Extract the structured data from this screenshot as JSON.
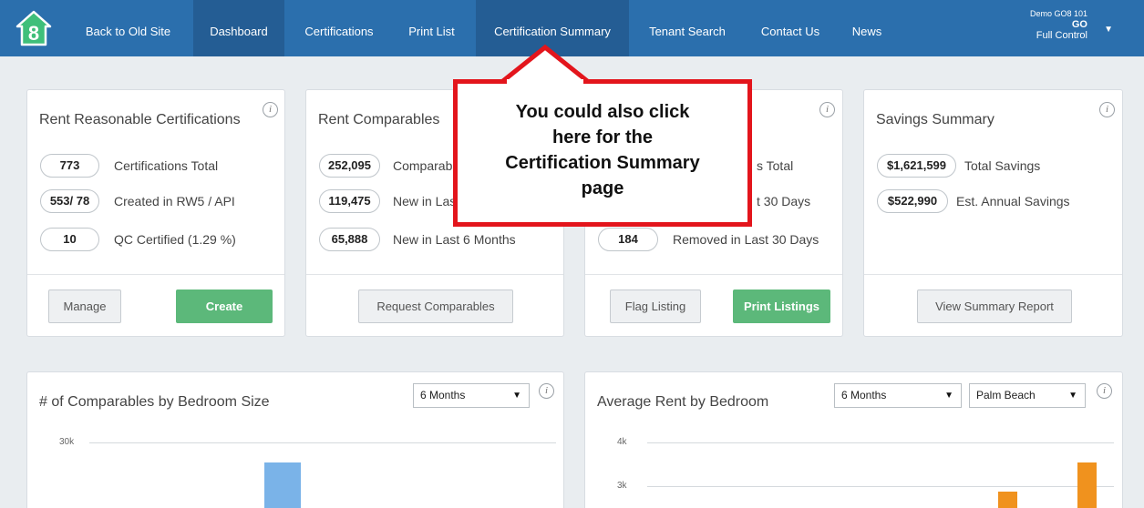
{
  "nav": {
    "items": [
      {
        "label": "Back to Old Site"
      },
      {
        "label": "Dashboard"
      },
      {
        "label": "Certifications"
      },
      {
        "label": "Print List"
      },
      {
        "label": "Certification Summary"
      },
      {
        "label": "Tenant Search"
      },
      {
        "label": "Contact Us"
      },
      {
        "label": "News"
      }
    ],
    "user": {
      "name": "Demo GO8 101",
      "code": "GO",
      "role": "Full Control"
    },
    "colors": {
      "bar": "#2b6fad",
      "active": "#245d94"
    }
  },
  "cards": {
    "rent_reasonable": {
      "title": "Rent Reasonable Certifications",
      "stats": [
        {
          "value": "773",
          "label": "Certifications Total"
        },
        {
          "value": "553/ 78",
          "label": "Created in RW5 / API"
        },
        {
          "value": "10",
          "label": "QC Certified (1.29 %)"
        }
      ],
      "btn_manage": "Manage",
      "btn_create": "Create"
    },
    "rent_comparables": {
      "title": "Rent Comparables",
      "stats": [
        {
          "value": "252,095",
          "label": "Comparables Total"
        },
        {
          "value": "119,475",
          "label": "New in Last 30 Days"
        },
        {
          "value": "65,888",
          "label": "New in Last 6 Months"
        }
      ],
      "btn_request": "Request Comparables"
    },
    "listings": {
      "stats": [
        {
          "label": "s Total"
        },
        {
          "label": "t 30 Days"
        },
        {
          "value": "184",
          "label": "Removed in Last 30 Days"
        }
      ],
      "btn_flag": "Flag Listing",
      "btn_print": "Print Listings"
    },
    "savings": {
      "title": "Savings Summary",
      "stats": [
        {
          "value": "$1,621,599",
          "label": "Total Savings"
        },
        {
          "value": "$522,990",
          "label": "Est. Annual Savings"
        }
      ],
      "btn_report": "View Summary Report"
    }
  },
  "charts": {
    "comparables_by_bedroom": {
      "title": "# of Comparables by Bedroom Size",
      "period": "6 Months",
      "y_ticks": [
        "30k"
      ],
      "bar_color": "#7ab3e8"
    },
    "avg_rent_by_bedroom": {
      "title": "Average Rent by Bedroom",
      "period": "6 Months",
      "region": "Palm Beach",
      "y_ticks": [
        "4k",
        "3k"
      ],
      "bar_color": "#f0921e"
    }
  },
  "callout": {
    "text_line1": "You could also click",
    "text_line2": "here for the",
    "text_line3": "Certification Summary",
    "text_line4": "page",
    "border_color": "#e3151c"
  }
}
